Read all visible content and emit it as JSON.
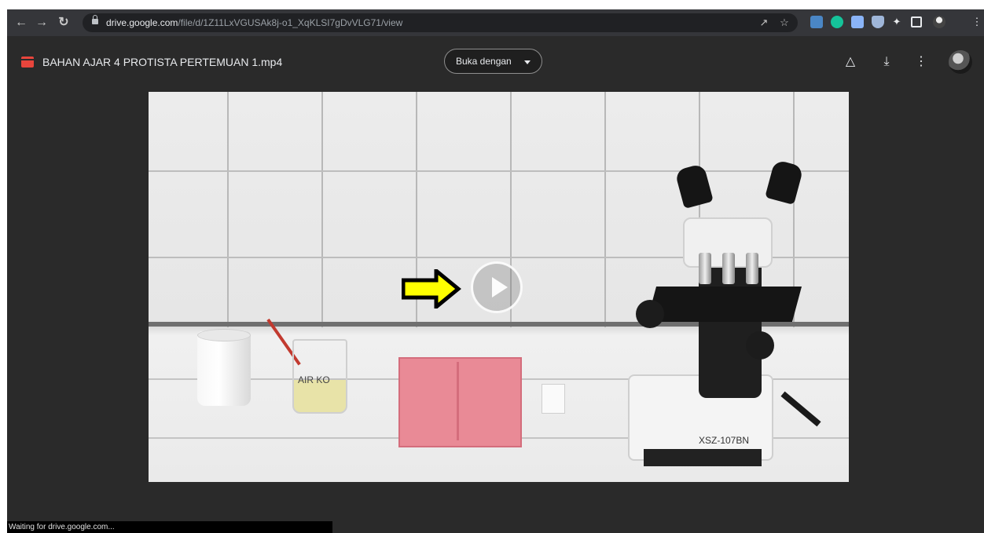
{
  "browser": {
    "url_host": "drive.google.com",
    "url_path": "/file/d/1Z11LxVGUSAk8j-o1_XqKLSI7gDvVLG71/view",
    "back_icon": "arrow-left-icon",
    "forward_icon": "arrow-right-icon",
    "reload_icon": "reload-icon",
    "extensions": [
      {
        "name": "share-icon",
        "color": "#c8c8c8"
      },
      {
        "name": "star-icon",
        "color": "#c8c8c8"
      },
      {
        "name": "extension-a-icon",
        "color": "#4a86c5"
      },
      {
        "name": "grammarly-icon",
        "color": "#15c39a"
      },
      {
        "name": "docs-icon",
        "color": "#8ab4f8"
      },
      {
        "name": "shield-icon",
        "color": "#9fb6d9"
      },
      {
        "name": "puzzle-icon",
        "color": "#e8eaed"
      },
      {
        "name": "sidepanel-icon",
        "color": "#e8eaed"
      },
      {
        "name": "profile-icon",
        "color": "#bbbbbb"
      },
      {
        "name": "menu-icon",
        "color": "#e8eaed"
      }
    ]
  },
  "drive": {
    "file_title": "BAHAN AJAR 4 PROTISTA PERTEMUAN 1.mp4",
    "open_with_label": "Buka dengan",
    "actions": [
      "add-to-drive-icon",
      "download-icon",
      "more-options-icon"
    ]
  },
  "video": {
    "beaker_label": "AIR KO",
    "microscope_model": "XSZ-107BN"
  },
  "status": {
    "text": "Waiting for drive.google.com..."
  },
  "colors": {
    "background": "#2a2a2a",
    "chrome": "#35363a",
    "arrow_fill": "#ffff00",
    "file_icon": "#e8453c"
  }
}
